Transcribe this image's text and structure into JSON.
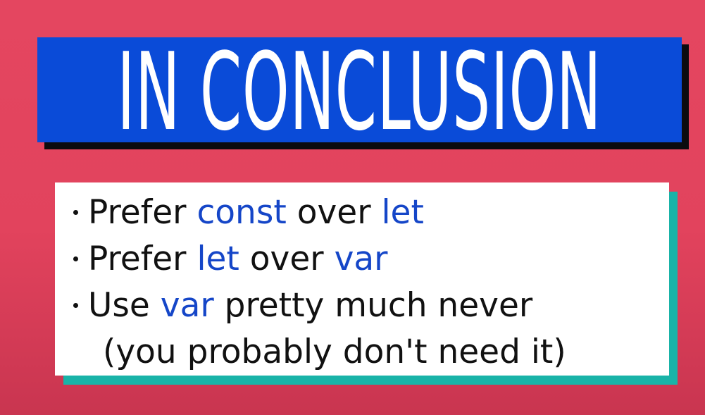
{
  "title": {
    "text": "IN CONCLUSION"
  },
  "bullets": [
    {
      "parts": [
        {
          "text": "Prefer ",
          "style": "normal"
        },
        {
          "text": "const",
          "style": "keyword"
        },
        {
          "text": " over ",
          "style": "normal"
        },
        {
          "text": "let",
          "style": "keyword"
        }
      ]
    },
    {
      "parts": [
        {
          "text": "Prefer ",
          "style": "normal"
        },
        {
          "text": "let",
          "style": "keyword"
        },
        {
          "text": " over ",
          "style": "normal"
        },
        {
          "text": "var",
          "style": "keyword"
        }
      ]
    },
    {
      "parts": [
        {
          "text": "Use ",
          "style": "normal"
        },
        {
          "text": "var",
          "style": "keyword"
        },
        {
          "text": " pretty much never",
          "style": "normal"
        }
      ],
      "continuation": "(you probably don't need it)"
    }
  ],
  "colors": {
    "background": "#e44660",
    "banner": "#0a4bd8",
    "banner_shadow": "#0b0b0f",
    "card": "#ffffff",
    "card_shadow": "#19b3a8",
    "keyword": "#1546c8",
    "text": "#111111"
  }
}
